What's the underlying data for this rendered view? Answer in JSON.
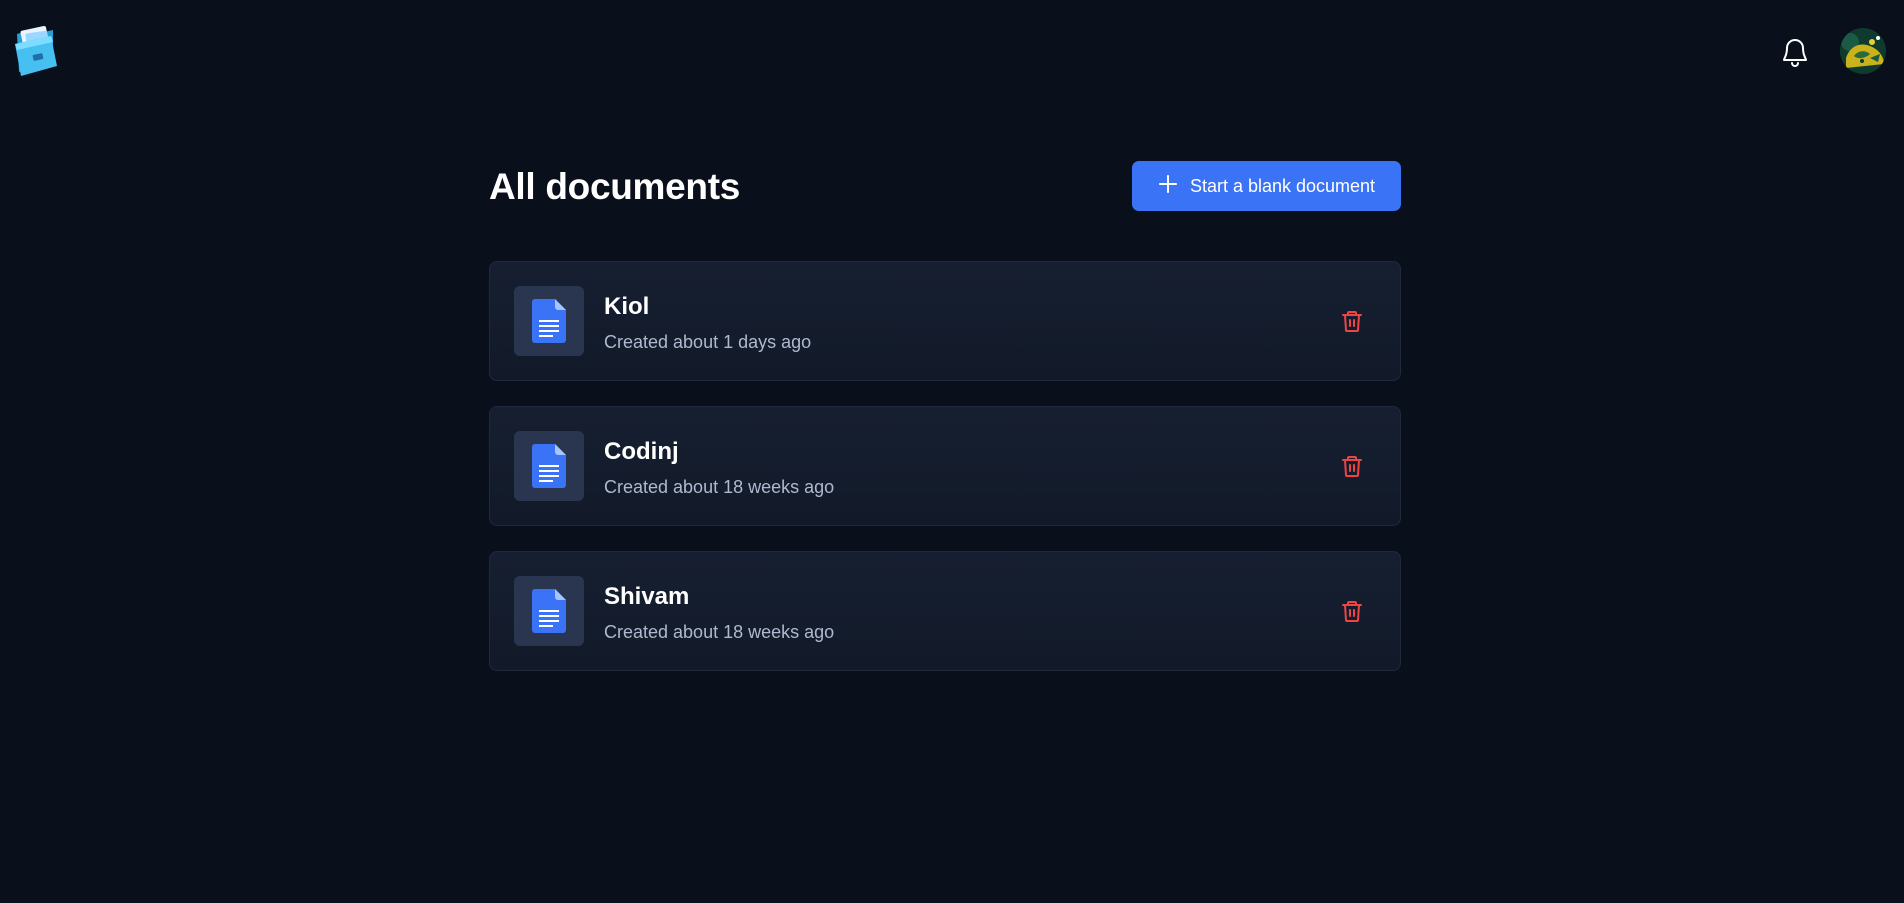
{
  "header": {
    "logo_icon": "folder-logo-icon",
    "notification_icon": "bell-icon",
    "avatar_icon": "user-avatar"
  },
  "main": {
    "title": "All documents",
    "new_document_label": "Start a blank document",
    "new_document_icon": "plus-icon"
  },
  "documents": [
    {
      "name": "Kiol",
      "created": "Created about 1 days ago",
      "icon": "document-icon"
    },
    {
      "name": "Codinj",
      "created": "Created about 18 weeks ago",
      "icon": "document-icon"
    },
    {
      "name": "Shivam",
      "created": "Created about 18 weeks ago",
      "icon": "document-icon"
    }
  ],
  "colors": {
    "background": "#0a0f1c",
    "card": "#141c2c",
    "accent": "#3b73f6",
    "danger": "#ef4444",
    "doc_icon": "#3b73f6",
    "muted_text": "#aeb9d0"
  }
}
